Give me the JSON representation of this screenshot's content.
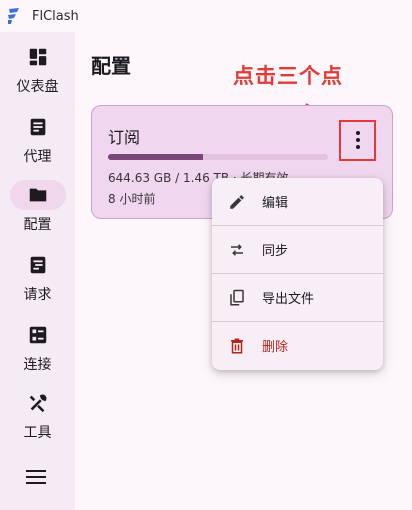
{
  "app": {
    "name": "FlClash"
  },
  "sidebar": {
    "items": [
      {
        "label": "仪表盘",
        "icon": "dashboard-icon"
      },
      {
        "label": "代理",
        "icon": "proxy-list-icon"
      },
      {
        "label": "配置",
        "icon": "folder-icon",
        "active": true
      },
      {
        "label": "请求",
        "icon": "requests-icon"
      },
      {
        "label": "连接",
        "icon": "connections-icon"
      },
      {
        "label": "工具",
        "icon": "tools-icon"
      }
    ],
    "menu_icon": "hamburger-menu-icon"
  },
  "page": {
    "title": "配置"
  },
  "annotation": {
    "text": "点击三个点",
    "color": "#e53935"
  },
  "profile_card": {
    "title": "订阅",
    "usage": "644.63 GB / 1.46 TB · 长期有效",
    "updated": "8 小时前",
    "progress_fraction": 0.43,
    "more_icon": "more-vertical-icon"
  },
  "popup_menu": {
    "items": [
      {
        "label": "编辑",
        "icon": "edit-icon",
        "danger": false
      },
      {
        "label": "同步",
        "icon": "sync-icon",
        "danger": false
      },
      {
        "label": "导出文件",
        "icon": "export-file-icon",
        "danger": false
      },
      {
        "label": "删除",
        "icon": "delete-icon",
        "danger": true
      }
    ]
  },
  "colors": {
    "accent": "#7a4779",
    "card_bg": "#f0d6ee",
    "danger": "#b3261e"
  }
}
